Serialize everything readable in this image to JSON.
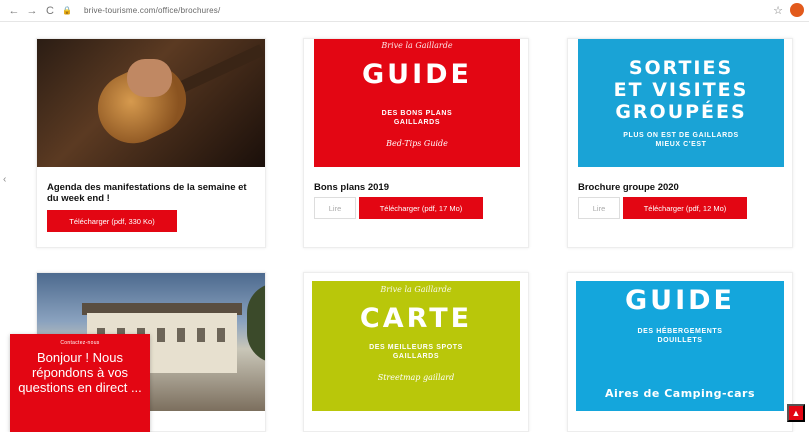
{
  "browser": {
    "url": "brive-tourisme.com/office/brochures/",
    "back": "←",
    "forward": "→",
    "reload": "C",
    "star": "☆"
  },
  "cards": [
    {
      "title": "Agenda des manifestations de la semaine et du week end !",
      "download": "Télécharger (pdf, 330 Ko)"
    },
    {
      "thumb_title": "GUIDE",
      "thumb_sub": "DES BONS PLANS GAILLARDS",
      "thumb_script": "Bed-Tips Guide",
      "thumb_top": "Brive la Gaillarde",
      "title": "Bons plans 2019",
      "read": "Lire",
      "download": "Télécharger (pdf, 17 Mo)"
    },
    {
      "thumb_title_1": "SORTIES",
      "thumb_title_2": "ET VISITES",
      "thumb_title_3": "GROUPÉES",
      "thumb_sub": "PLUS ON EST DE GAILLARDS MIEUX C'EST",
      "title": "Brochure groupe 2020",
      "read": "Lire",
      "download": "Télécharger (pdf, 12 Mo)"
    },
    {
      "thumb_title": "CARTE",
      "thumb_sub": "DES MEILLEURS SPOTS GAILLARDS",
      "thumb_script": "Streetmap gaillard",
      "thumb_top": "Brive la Gaillarde"
    },
    {
      "thumb_title": "GUIDE",
      "thumb_sub": "DES HÉBERGEMENTS DOUILLETS",
      "thumb_bottom": "Aires de Camping-cars"
    }
  ],
  "chat": {
    "small": "Contactez-nous",
    "message": "Bonjour ! Nous répondons à vos questions en direct ..."
  },
  "colors": {
    "brand_red": "#e30613",
    "sky_blue": "#1aa3d6",
    "lime": "#b9c70a"
  },
  "icons": {
    "scroll_top": "▲",
    "side_arrow": "‹"
  }
}
